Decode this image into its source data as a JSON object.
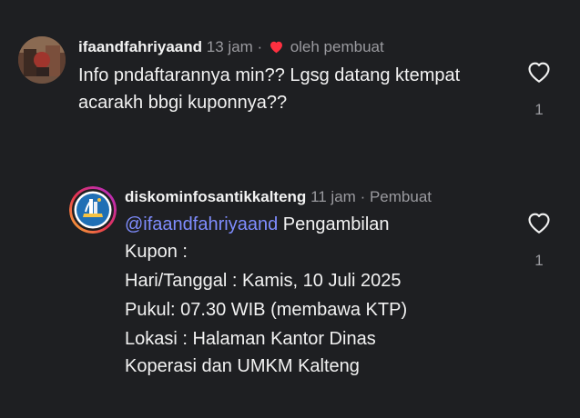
{
  "comments": [
    {
      "username": "ifaandfahriyaand",
      "time": "13 jam",
      "separator": "·",
      "author_liked_label": "oleh pembuat",
      "text": "Info pndaftarannya min?? Lgsg datang ktempat acarakh bbgi kuponnya??",
      "like_count": "1",
      "colors": {
        "heart": "#ff3040"
      }
    },
    {
      "username": "diskominfosantikkalteng",
      "time": "11 jam",
      "separator": "·",
      "author_tag": "Pembuat",
      "mention": "@ifaandfahriyaand",
      "lines": [
        "Pengambilan",
        "Kupon :",
        "Hari/Tanggal : Kamis, 10 Juli 2025",
        "Pukul: 07.30 WIB (membawa KTP)",
        "Lokasi : Halaman Kantor Dinas",
        "Koperasi dan UMKM Kalteng"
      ],
      "like_count": "1"
    }
  ],
  "colors": {
    "background": "#1e1f22",
    "mention": "#7f8dff",
    "muted": "#9a9a9f"
  }
}
